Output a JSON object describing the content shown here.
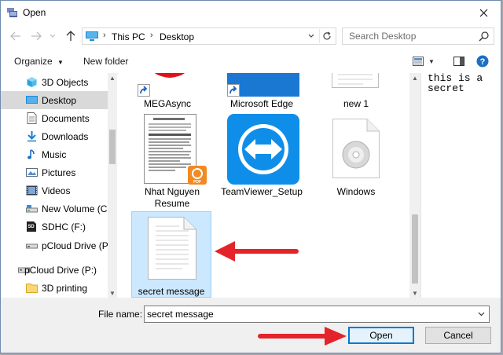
{
  "window": {
    "title": "Open"
  },
  "address": {
    "segments": [
      "This PC",
      "Desktop"
    ]
  },
  "search": {
    "placeholder": "Search Desktop"
  },
  "toolbar": {
    "organize_label": "Organize",
    "new_folder_label": "New folder"
  },
  "nav": {
    "items": [
      {
        "label": "3D Objects",
        "icon": "cube-icon"
      },
      {
        "label": "Desktop",
        "icon": "desktop-icon",
        "selected": true
      },
      {
        "label": "Documents",
        "icon": "document-icon"
      },
      {
        "label": "Downloads",
        "icon": "download-icon"
      },
      {
        "label": "Music",
        "icon": "music-icon"
      },
      {
        "label": "Pictures",
        "icon": "pictures-icon"
      },
      {
        "label": "Videos",
        "icon": "video-icon"
      },
      {
        "label": "New Volume (C:",
        "icon": "drive-icon"
      },
      {
        "label": "SDHC (F:)",
        "icon": "sd-card-icon"
      },
      {
        "label": "pCloud Drive (P:",
        "icon": "drive-icon"
      },
      {
        "label": "pCloud Drive (P:)",
        "icon": "drive-icon"
      },
      {
        "label": "3D printing",
        "icon": "folder-icon"
      }
    ],
    "sd_badge": "SD"
  },
  "files": [
    {
      "label": "MEGAsync",
      "icon": "megasync-shortcut-icon"
    },
    {
      "label": "Microsoft Edge",
      "icon": "edge-shortcut-icon"
    },
    {
      "label": "new 1",
      "icon": "text-file-icon"
    },
    {
      "label": "Nhat Nguyen Resume",
      "icon": "pdf-document-icon",
      "badge": "PDF"
    },
    {
      "label": "TeamViewer_Setup",
      "icon": "teamviewer-icon"
    },
    {
      "label": "Windows",
      "icon": "disc-image-icon"
    },
    {
      "label": "secret message",
      "icon": "text-file-icon",
      "selected": true
    }
  ],
  "preview": {
    "text": "this is a secret"
  },
  "filename": {
    "label": "File name:",
    "value": "secret message"
  },
  "buttons": {
    "open_label": "Open",
    "cancel_label": "Cancel"
  },
  "colors": {
    "accent": "#0078d7",
    "selection": "#cce8ff",
    "annotation": "#e3242b"
  }
}
